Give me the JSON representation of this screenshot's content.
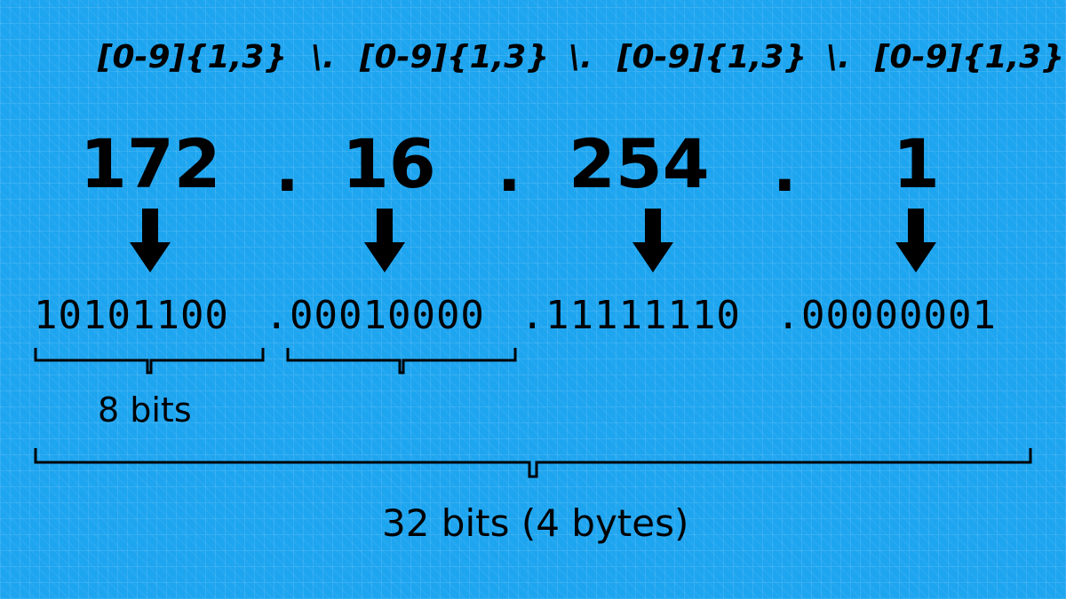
{
  "regex": {
    "group": "[0-9]{1,3}",
    "sep": "\\."
  },
  "ip": {
    "decimal": [
      "172",
      "16",
      "254",
      "1"
    ],
    "dot": ".",
    "binary": [
      "10101100",
      "00010000",
      "11111110",
      "00000001"
    ]
  },
  "labels": {
    "eight_bits": "8 bits",
    "thirty_two_bits": "32 bits (4 bytes)"
  }
}
